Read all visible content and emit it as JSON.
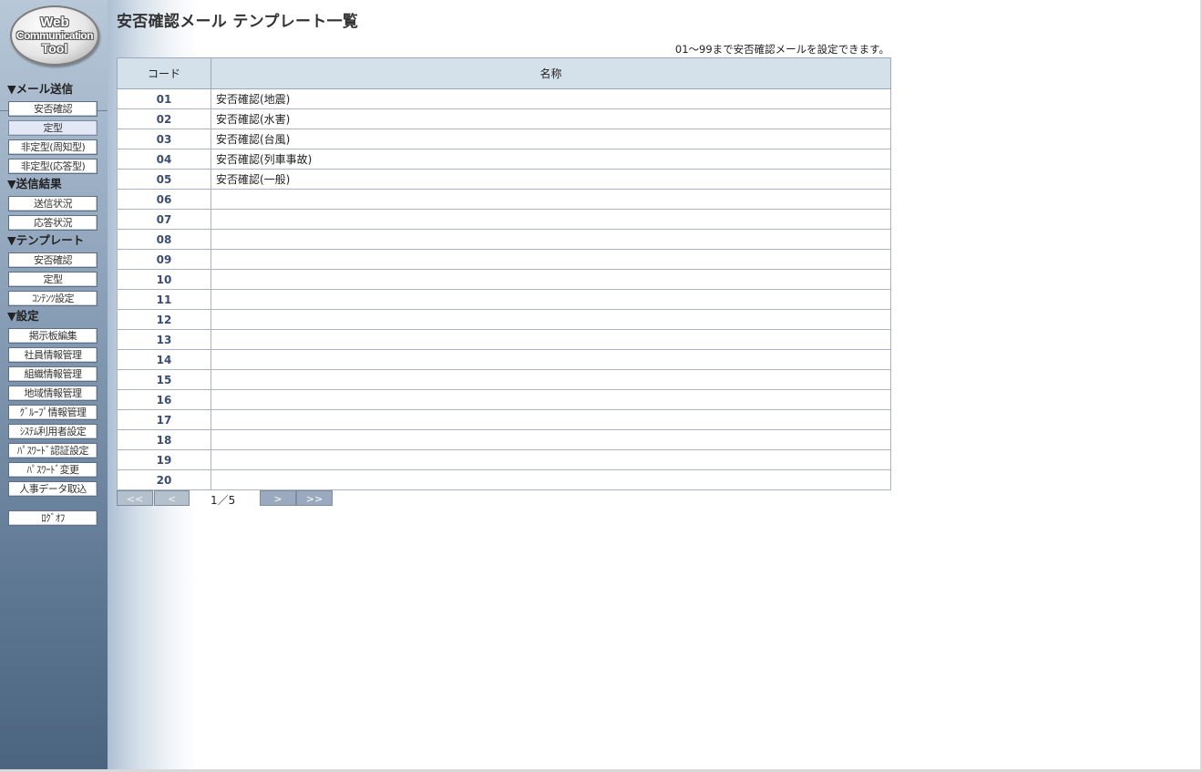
{
  "logo": {
    "line1": "Web",
    "line2": "Communication",
    "line3": "Tool"
  },
  "sidebar": {
    "sections": [
      {
        "title": "▼メール送信",
        "items": [
          "安否確認",
          "定型",
          "非定型(周知型)",
          "非定型(応答型)"
        ]
      },
      {
        "title": "▼送信結果",
        "items": [
          "送信状況",
          "応答状況"
        ]
      },
      {
        "title": "▼テンプレート",
        "items": [
          "安否確認",
          "定型",
          "ｺﾝﾃﾝﾂ設定"
        ]
      },
      {
        "title": "▼設定",
        "items": [
          "掲示板編集",
          "社員情報管理",
          "組織情報管理",
          "地域情報管理",
          "ｸﾞﾙｰﾌﾟ情報管理",
          "ｼｽﾃﾑ利用者設定",
          "ﾊﾟｽﾜｰﾄﾞ認証設定",
          "ﾊﾟｽﾜｰﾄﾞ変更",
          "人事データ取込"
        ]
      }
    ],
    "logout": "ﾛｸﾞｵﾌ"
  },
  "page": {
    "title": "安否確認メール テンプレート一覧",
    "note": "01～99まで安否確認メールを設定できます。"
  },
  "table": {
    "headers": {
      "code": "コード",
      "name": "名称"
    },
    "rows": [
      {
        "code": "01",
        "name": "安否確認(地震)"
      },
      {
        "code": "02",
        "name": "安否確認(水害)"
      },
      {
        "code": "03",
        "name": "安否確認(台風)"
      },
      {
        "code": "04",
        "name": "安否確認(列車事故)"
      },
      {
        "code": "05",
        "name": "安否確認(一般)"
      },
      {
        "code": "06",
        "name": ""
      },
      {
        "code": "07",
        "name": ""
      },
      {
        "code": "08",
        "name": ""
      },
      {
        "code": "09",
        "name": ""
      },
      {
        "code": "10",
        "name": ""
      },
      {
        "code": "11",
        "name": ""
      },
      {
        "code": "12",
        "name": ""
      },
      {
        "code": "13",
        "name": ""
      },
      {
        "code": "14",
        "name": ""
      },
      {
        "code": "15",
        "name": ""
      },
      {
        "code": "16",
        "name": ""
      },
      {
        "code": "17",
        "name": ""
      },
      {
        "code": "18",
        "name": ""
      },
      {
        "code": "19",
        "name": ""
      },
      {
        "code": "20",
        "name": ""
      }
    ]
  },
  "pager": {
    "first": "<<",
    "prev": "<",
    "page_text": "1／5",
    "next": ">",
    "last": ">>"
  }
}
